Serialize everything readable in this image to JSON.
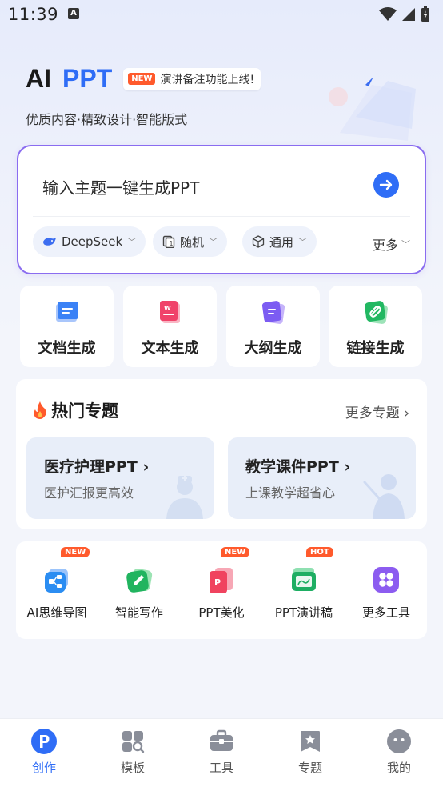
{
  "status_bar": {
    "time": "11:39",
    "notification_icon": "A"
  },
  "hero": {
    "title_ai": "AI",
    "title_ppt": "PPT",
    "badge_new": "NEW",
    "badge_text": "演讲备注功能上线!",
    "subtitle": "优质内容·精致设计·智能版式"
  },
  "input": {
    "placeholder": "输入主题一键生成PPT",
    "options": {
      "model": "DeepSeek",
      "pages": "随机",
      "style": "通用",
      "more": "更多"
    }
  },
  "generation": [
    {
      "label": "文档生成",
      "icon": "document-icon"
    },
    {
      "label": "文本生成",
      "icon": "text-doc-icon"
    },
    {
      "label": "大纲生成",
      "icon": "outline-icon"
    },
    {
      "label": "链接生成",
      "icon": "link-icon"
    }
  ],
  "hot_topics": {
    "title": "热门专题",
    "more": "更多专题",
    "cards": [
      {
        "title": "医疗护理PPT",
        "subtitle": "医护汇报更高效"
      },
      {
        "title": "教学课件PPT",
        "subtitle": "上课教学超省心"
      }
    ]
  },
  "tools": [
    {
      "label": "AI思维导图",
      "badge": "NEW",
      "icon": "mindmap-icon"
    },
    {
      "label": "智能写作",
      "badge": "",
      "icon": "pen-icon"
    },
    {
      "label": "PPT美化",
      "badge": "NEW",
      "icon": "ppt-beautify-icon"
    },
    {
      "label": "PPT演讲稿",
      "badge": "HOT",
      "icon": "speech-icon"
    },
    {
      "label": "更多工具",
      "badge": "",
      "icon": "more-tools-icon"
    }
  ],
  "bottom_nav": [
    {
      "label": "创作",
      "active": true
    },
    {
      "label": "模板",
      "active": false
    },
    {
      "label": "工具",
      "active": false
    },
    {
      "label": "专题",
      "active": false
    },
    {
      "label": "我的",
      "active": false
    }
  ],
  "colors": {
    "accent": "#2f6df6",
    "input_border": "#8a6cf0",
    "badge": "#ff5a2c"
  }
}
